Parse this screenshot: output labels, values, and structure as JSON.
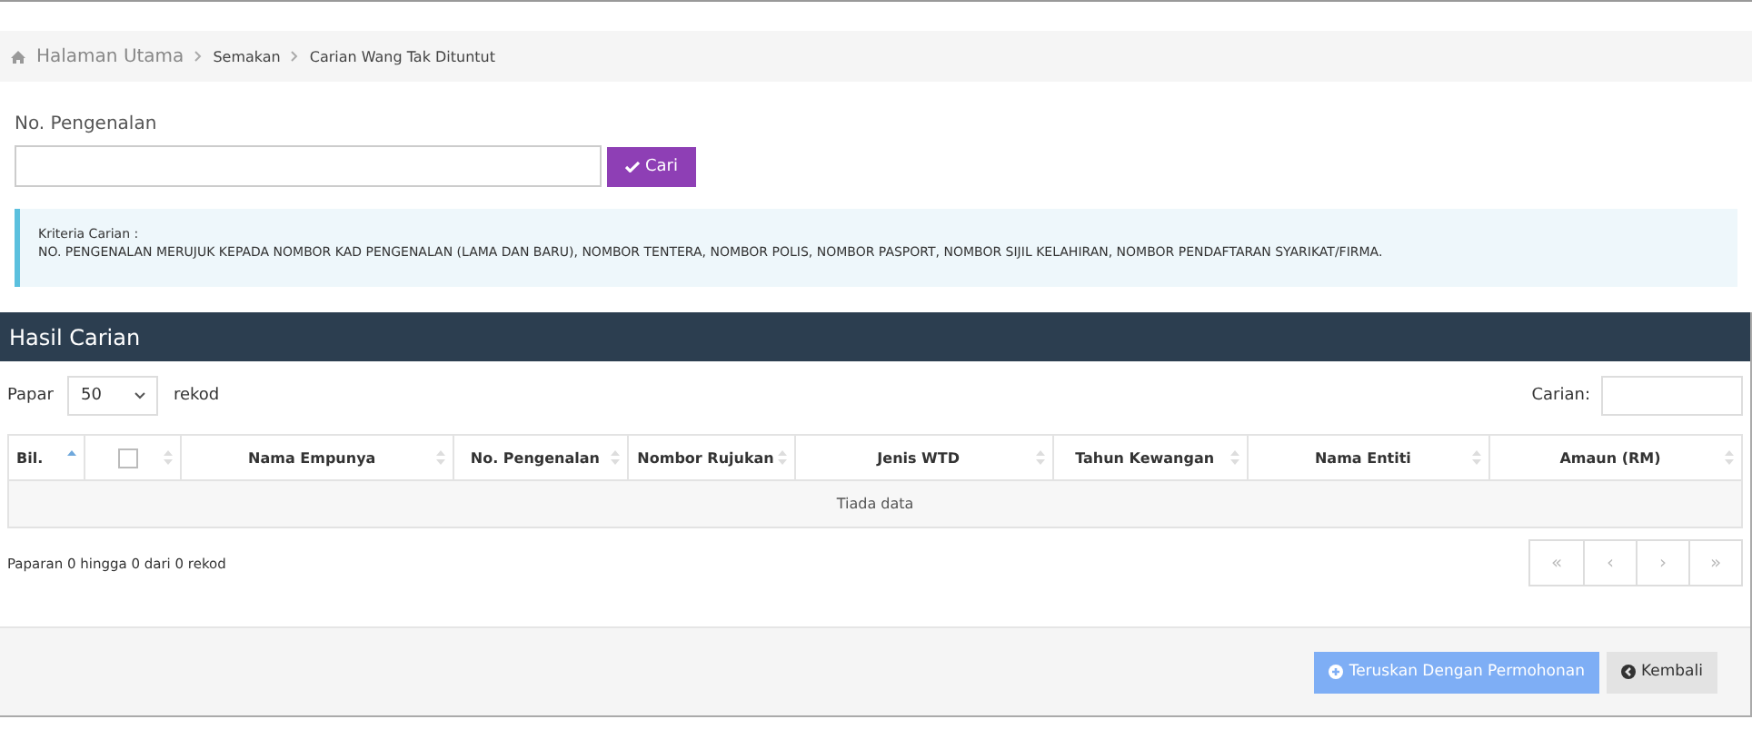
{
  "breadcrumb": [
    {
      "label": "Halaman Utama"
    },
    {
      "label": "Semakan"
    },
    {
      "label": "Carian Wang Tak Dituntut"
    }
  ],
  "search_form": {
    "label": "No. Pengenalan",
    "button": "Cari"
  },
  "info": {
    "title": "Kriteria Carian :",
    "text": "NO. PENGENALAN MERUJUK KEPADA NOMBOR KAD PENGENALAN (LAMA DAN BARU), NOMBOR TENTERA, NOMBOR POLIS, NOMBOR PASPORT, NOMBOR SIJIL KELAHIRAN, NOMBOR PENDAFTARAN SYARIKAT/FIRMA."
  },
  "results": {
    "title": "Hasil Carian",
    "length": {
      "before": "Papar",
      "value": "50",
      "after": "rekod"
    },
    "filter_label": "Carian:",
    "columns": [
      {
        "kind": "text",
        "label": "Bil.",
        "sorted": true
      },
      {
        "kind": "checkbox",
        "checked": false,
        "sorted": false
      },
      {
        "kind": "text",
        "label": "Nama Empunya",
        "sorted": false
      },
      {
        "kind": "text",
        "label": "No. Pengenalan",
        "sorted": false
      },
      {
        "kind": "text",
        "label": "Nombor Rujukan",
        "sorted": false
      },
      {
        "kind": "text",
        "label": "Jenis WTD",
        "sorted": false
      },
      {
        "kind": "text",
        "label": "Tahun Kewangan",
        "sorted": false
      },
      {
        "kind": "text",
        "label": "Nama Entiti",
        "sorted": false
      },
      {
        "kind": "text",
        "label": "Amaun (RM)",
        "sorted": false
      }
    ],
    "empty_text": "Tiada data",
    "summary": "Paparan 0 hingga 0 dari 0 rekod",
    "pagination": [
      {
        "label": "«",
        "disabled": true
      },
      {
        "label": "‹",
        "disabled": true
      },
      {
        "label": "›",
        "disabled": true
      },
      {
        "label": "»",
        "disabled": true
      }
    ]
  },
  "footer_buttons": [
    {
      "kind": "primary",
      "label": "Teruskan Dengan Permohonan",
      "disabled": true
    },
    {
      "kind": "default",
      "label": "Kembali",
      "disabled": false
    }
  ]
}
